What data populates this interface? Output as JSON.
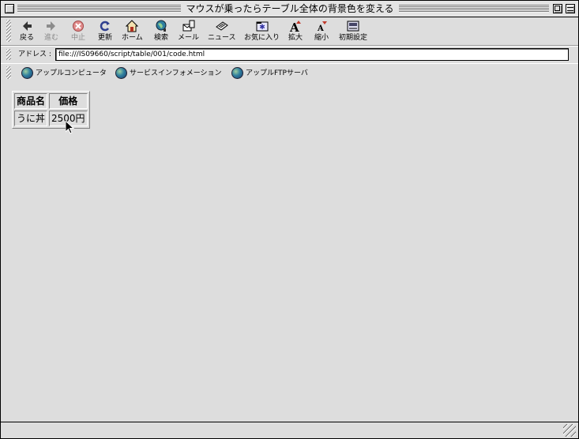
{
  "window": {
    "title": "マウスが乗ったらテーブル全体の背景色を変える"
  },
  "toolbar": {
    "buttons": [
      {
        "label": "戻る",
        "icon": "back-arrow-icon",
        "enabled": true
      },
      {
        "label": "進む",
        "icon": "forward-arrow-icon",
        "enabled": false
      },
      {
        "label": "中止",
        "icon": "stop-icon",
        "enabled": false
      },
      {
        "label": "更新",
        "icon": "refresh-icon",
        "enabled": true
      },
      {
        "label": "ホーム",
        "icon": "home-icon",
        "enabled": true
      },
      {
        "label": "検索",
        "icon": "search-globe-icon",
        "enabled": true
      },
      {
        "label": "メール",
        "icon": "mail-icon",
        "enabled": true
      },
      {
        "label": "ニュース",
        "icon": "news-icon",
        "enabled": true
      },
      {
        "label": "お気に入り",
        "icon": "favorites-icon",
        "enabled": true
      },
      {
        "label": "拡大",
        "icon": "font-larger-icon",
        "enabled": true
      },
      {
        "label": "縮小",
        "icon": "font-smaller-icon",
        "enabled": true
      },
      {
        "label": "初期設定",
        "icon": "preferences-icon",
        "enabled": true
      }
    ]
  },
  "address": {
    "label": "アドレス :",
    "value": "file:///IS09660/script/table/001/code.html"
  },
  "favorites": [
    {
      "label": "アップルコンピュータ",
      "icon": "globe-icon"
    },
    {
      "label": "サービスインフォメーション",
      "icon": "globe-icon"
    },
    {
      "label": "アップルFTPサーバ",
      "icon": "globe-icon"
    }
  ],
  "table": {
    "headers": [
      "商品名",
      "価格"
    ],
    "rows": [
      [
        "うに丼",
        "2500円"
      ]
    ]
  },
  "colors": {
    "background": "#dddddd",
    "stop_icon": "#d25656",
    "refresh_icon": "#2f3f8f",
    "font_arrow": "#c0392b"
  }
}
